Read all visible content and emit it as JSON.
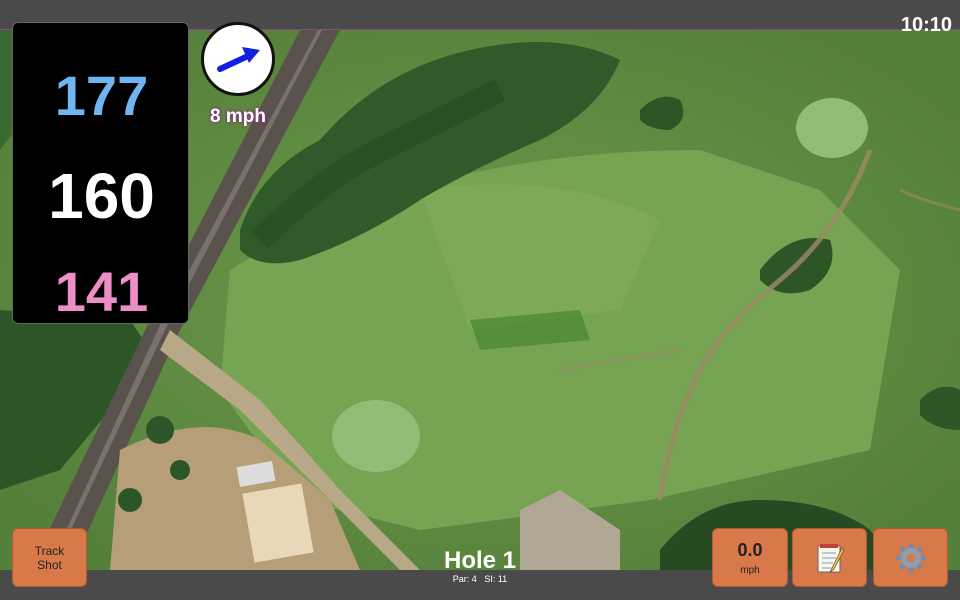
{
  "status": {
    "time": "10:10"
  },
  "distances": {
    "back": "177",
    "center": "160",
    "front": "141"
  },
  "wind": {
    "speed_label": "8 mph",
    "icon": "wind-arrow-icon"
  },
  "hole": {
    "title": "Hole 1",
    "par_label": "Par: 4",
    "si_label": "SI: 11"
  },
  "buttons": {
    "track_shot_line1": "Track",
    "track_shot_line2": "Shot",
    "speed_value": "0.0",
    "speed_unit": "mph",
    "notes_icon": "notepad-icon",
    "settings_icon": "gear-icon"
  },
  "colors": {
    "back": "#6fb5f0",
    "center": "#ffffff",
    "front": "#ee8ec6",
    "button": "#d9794a",
    "bar": "#4a4a4a"
  }
}
